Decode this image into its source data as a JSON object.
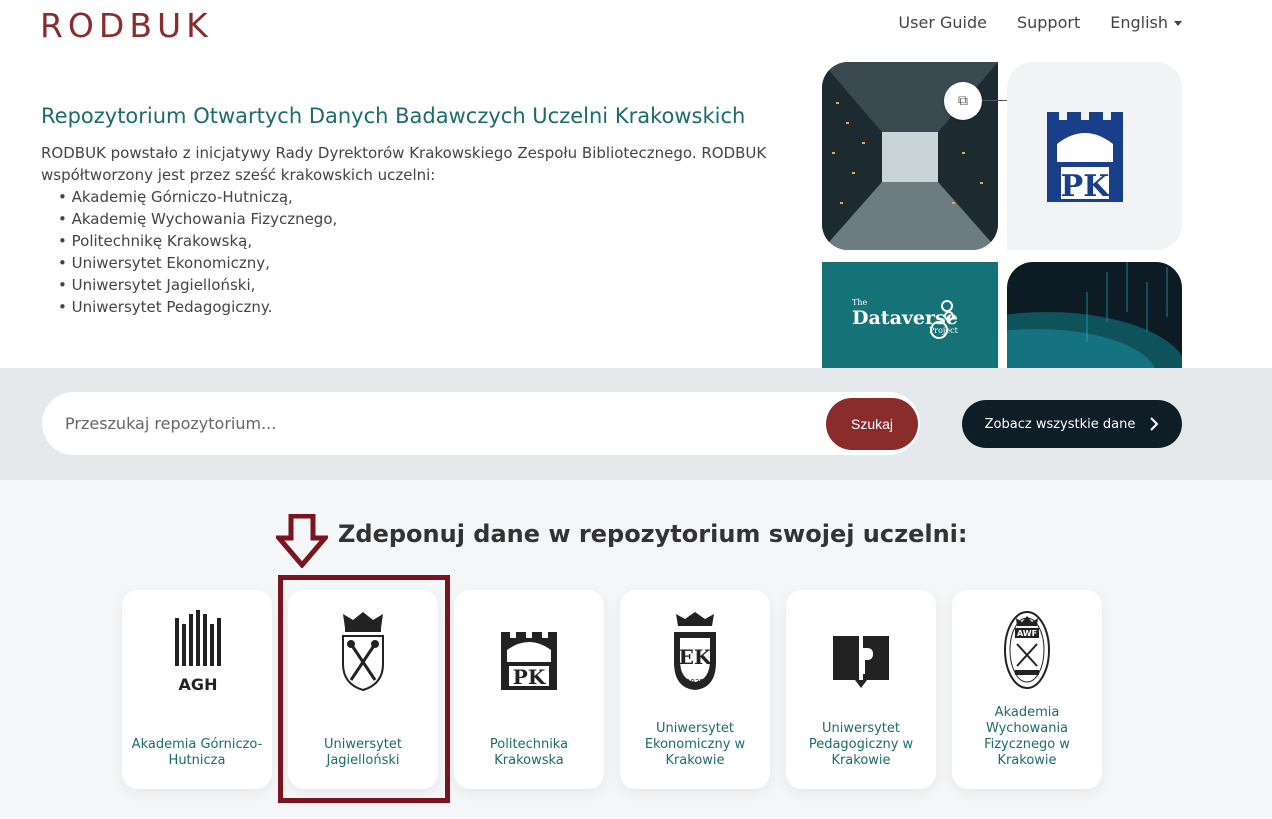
{
  "header": {
    "logo": "RODBUK",
    "nav": {
      "user_guide": "User Guide",
      "support": "Support",
      "language": "English"
    }
  },
  "intro": {
    "title": "Repozytorium Otwartych Danych Badawczych Uczelni Krakowskich",
    "description": "RODBUK powstało z inicjatywy Rady Dyrektorów Krakowskiego Zespołu Bibliotecznego. RODBUK współtworzony jest przez sześć krakowskich uczelni:",
    "list": [
      "Akademię Górniczo-Hutniczą,",
      "Akademię Wychowania Fizycznego,",
      "Politechnikę Krakowską,",
      "Uniwersytet Ekonomiczny,",
      "Uniwersytet Jagielloński,",
      "Uniwersytet Pedagogiczny."
    ]
  },
  "tiles": {
    "dataverse_the": "The",
    "dataverse_name": "Dataverse",
    "dataverse_project": "Project",
    "pk_logo": "PK"
  },
  "search": {
    "placeholder": "Przeszukaj repozytorium...",
    "button": "Szukaj",
    "all_data_button": "Zobacz wszystkie dane"
  },
  "deposit": {
    "heading": "Zdeponuj dane w repozytorium swojej uczelni:",
    "universities": [
      {
        "name": "Akademia Górniczo-Hutnicza",
        "logo_text": "AGH"
      },
      {
        "name": "Uniwersytet Jagielloński"
      },
      {
        "name": "Politechnika Krakowska",
        "logo_text": "PK"
      },
      {
        "name": "Uniwersytet Ekonomiczny w Krakowie",
        "logo_text": "1925"
      },
      {
        "name": "Uniwersytet Pedagogiczny w Krakowie"
      },
      {
        "name": "Akademia Wychowania Fizycznego w Krakowie",
        "logo_text": "AWF"
      }
    ]
  },
  "colors": {
    "brand": "#8a2c2c",
    "teal": "#1c6b6d",
    "dark": "#0f1e26",
    "highlight": "#7a1420"
  }
}
